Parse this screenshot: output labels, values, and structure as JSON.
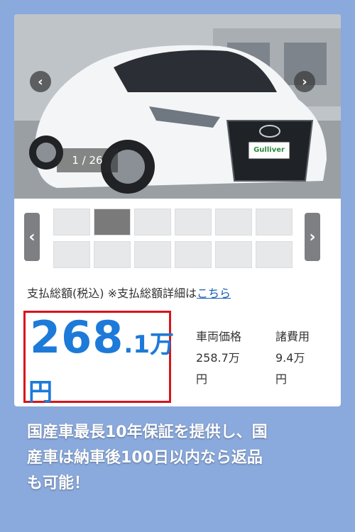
{
  "gallery": {
    "counter": "1 / 26",
    "prev_icon": "chevron-left-icon",
    "next_icon": "chevron-right-icon",
    "dealer_plate": "Gulliver",
    "thumbnails_count": 12
  },
  "price": {
    "label_prefix": "支払総額(税込) ※支払総額詳細は",
    "label_link": "こちら",
    "total_main": "268",
    "total_decimal": ".1万",
    "total_unit": "円",
    "vehicle_label": "車両価格",
    "vehicle_value": "258.7万",
    "vehicle_unit": "円",
    "fees_label": "諸費用",
    "fees_value": "9.4万",
    "fees_unit": "円"
  },
  "caption": {
    "line1": "国産車最長10年保証を提供し、国",
    "line2": "産車は納車後100日以内なら返品",
    "line3": "も可能！"
  },
  "colors": {
    "background": "#8aa9dc",
    "price_blue": "#1d7ad8",
    "highlight_red": "#d9141b",
    "link_blue": "#1a5fb4"
  }
}
